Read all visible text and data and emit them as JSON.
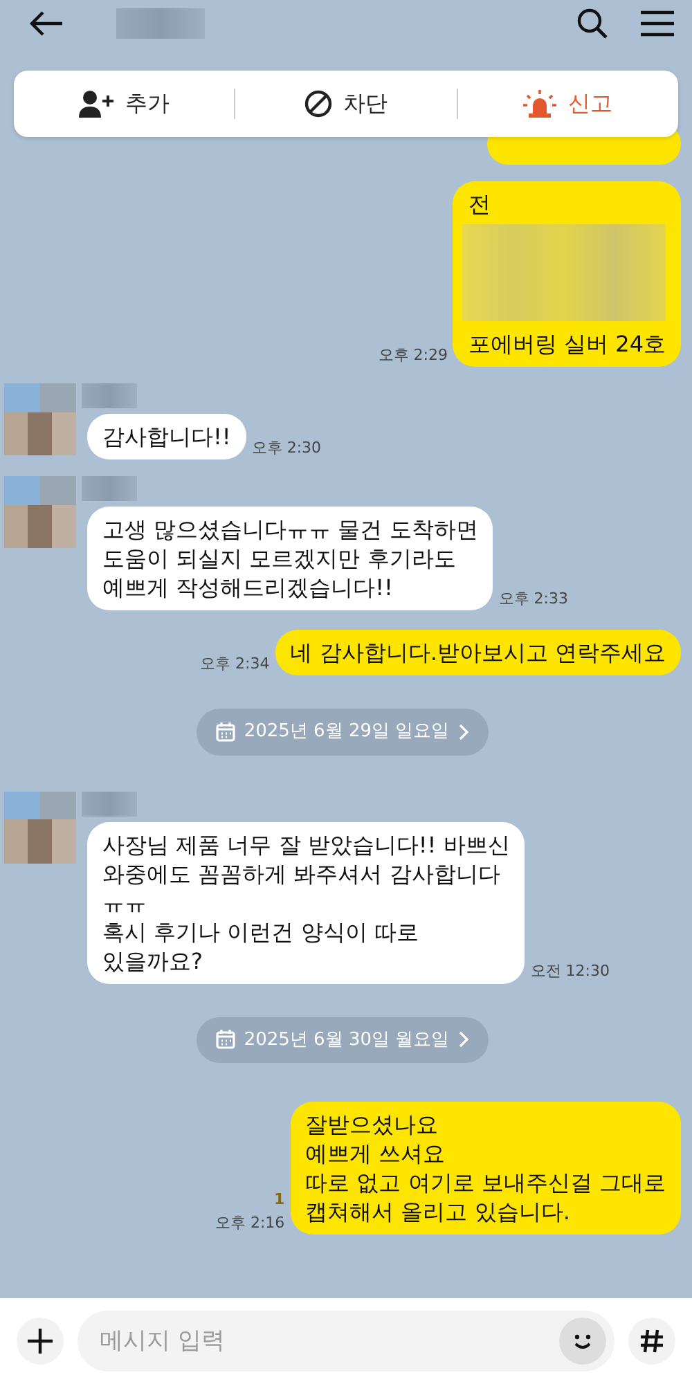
{
  "action_bar": [
    {
      "kind": "add",
      "label": "추가",
      "color": "#222222"
    },
    {
      "kind": "block",
      "label": "차단",
      "color": "#222222"
    },
    {
      "kind": "report",
      "label": "신고",
      "color": "#e4572e"
    }
  ],
  "messages": [
    {
      "kind": "hidden"
    },
    {
      "kind": "sent",
      "segments": [
        {
          "kind": "text",
          "text": "전"
        },
        {
          "kind": "redacted"
        },
        {
          "kind": "text",
          "text": "포에버링 실버 24호"
        }
      ],
      "time": "오후 2:29"
    },
    {
      "kind": "received",
      "text": "감사합니다!!",
      "time": "오후 2:30"
    },
    {
      "kind": "received",
      "text": "고생 많으셨습니다ㅠㅠ 물건 도착하면\n도움이 되실지 모르겠지만 후기라도\n예쁘게 작성해드리겠습니다!!",
      "time": "오후 2:33"
    },
    {
      "kind": "sent",
      "text": "네 감사합니다.받아보시고 연락주세요",
      "time": "오후 2:34"
    },
    {
      "kind": "date",
      "text": "2025년 6월 29일 일요일"
    },
    {
      "kind": "received",
      "text": "사장님 제품 너무 잘 받았습니다!! 바쁘신\n와중에도 꼼꼼하게 봐주셔서 감사합니다\nㅠㅠ\n혹시 후기나 이런건 양식이 따로\n있을까요?",
      "time": "오전 12:30"
    },
    {
      "kind": "date",
      "text": "2025년 6월 30일 월요일"
    },
    {
      "kind": "sent",
      "text": "잘받으셨나요\n예쁘게 쓰셔요\n따로 없고 여기로 보내주신걸 그대로\n캡쳐해서 올리고 있습니다.",
      "time": "오후 2:16",
      "unread": "1"
    }
  ],
  "input": {
    "placeholder": "메시지 입력"
  }
}
